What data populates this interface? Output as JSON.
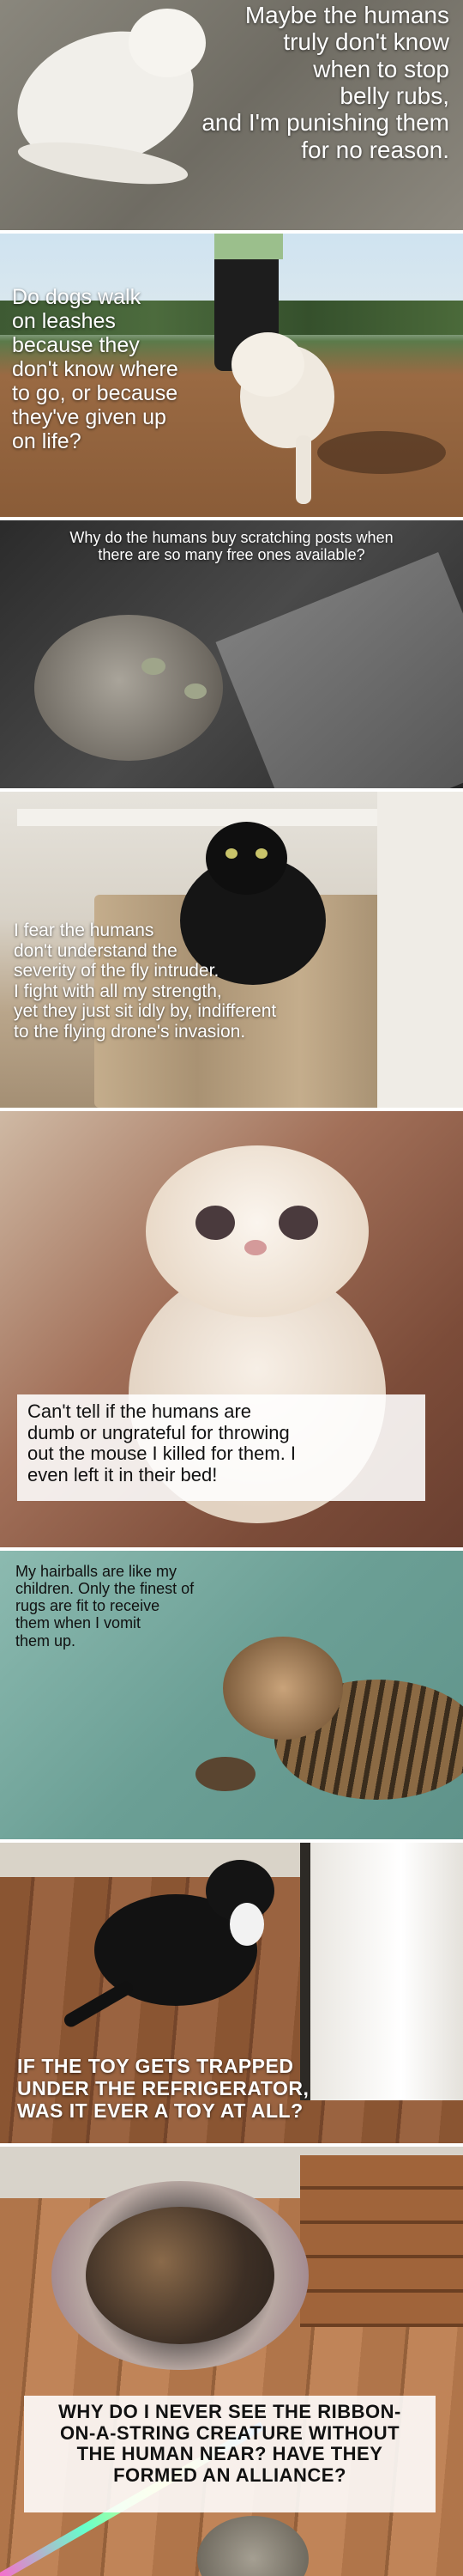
{
  "panels": [
    {
      "caption": "Maybe the humans truly don't know when to stop belly rubs, and I'm punishing them for no reason.",
      "lines": [
        "Maybe the humans",
        "truly don't know",
        "when to stop",
        "belly rubs,",
        "and I'm punishing them",
        "for no reason."
      ]
    },
    {
      "caption": "Do dogs walk on leashes because they don't know where to go, or because they've given up on life?",
      "lines": [
        "Do dogs walk",
        "on leashes",
        "because they",
        "don't know where",
        "to go, or because",
        "they've given up",
        "on life?"
      ]
    },
    {
      "caption": "Why do the humans buy scratching posts when there are so many free ones available?",
      "lines": [
        "Why do the humans buy scratching posts when",
        "there are so many free ones available?"
      ]
    },
    {
      "caption": "I fear the humans don't understand the severity of the fly intruder. I fight with all my strength, yet they just sit idly by, indifferent to the flying drone's invasion.",
      "lines": [
        "I fear the humans",
        "don't understand the",
        "severity of the fly intruder.",
        "I fight with all my strength,",
        "yet they just sit idly by, indifferent",
        "to the flying drone's invasion."
      ]
    },
    {
      "caption": "Can't tell if the humans are dumb or ungrateful for throwing out the mouse I killed for them. I even left it in their bed!",
      "lines": [
        "Can't tell if the humans are",
        "dumb or ungrateful for throwing",
        "out the mouse I killed for them. I",
        "even left it in their bed!"
      ]
    },
    {
      "caption": "My hairballs are like my children. Only the finest of rugs are fit to receive them when I vomit them up.",
      "lines": [
        "My hairballs are like my",
        "children. Only the finest of",
        "rugs are fit to receive",
        "them when I vomit",
        "them up."
      ]
    },
    {
      "caption": "IF THE TOY GETS TRAPPED UNDER THE REFRIGERATOR, WAS IT EVER A TOY AT ALL?",
      "lines": [
        "IF THE TOY GETS TRAPPED",
        "UNDER THE REFRIGERATOR,",
        "WAS IT EVER A TOY AT ALL?"
      ]
    },
    {
      "caption": "WHY DO I NEVER SEE THE RIBBON-ON-A-STRING CREATURE WITHOUT THE HUMAN NEAR? HAVE THEY FORMED AN ALLIANCE?",
      "lines": [
        "WHY DO I NEVER SEE THE RIBBON-",
        "ON-A-STRING CREATURE WITHOUT",
        "THE HUMAN NEAR? HAVE THEY",
        "FORMED AN ALLIANCE?"
      ]
    }
  ],
  "colors": {
    "carpet": "#7b7a72",
    "dirt_path": "#9a6a43",
    "sky": "#cfe3f0",
    "scratch_bg": "#3b3b3b",
    "room_beige": "#b9a58a",
    "kitten_bg": "#8a5a45",
    "rug_teal": "#6b9f95",
    "wood_floor": "#7a4a2a",
    "dresser": "#a0643a"
  }
}
